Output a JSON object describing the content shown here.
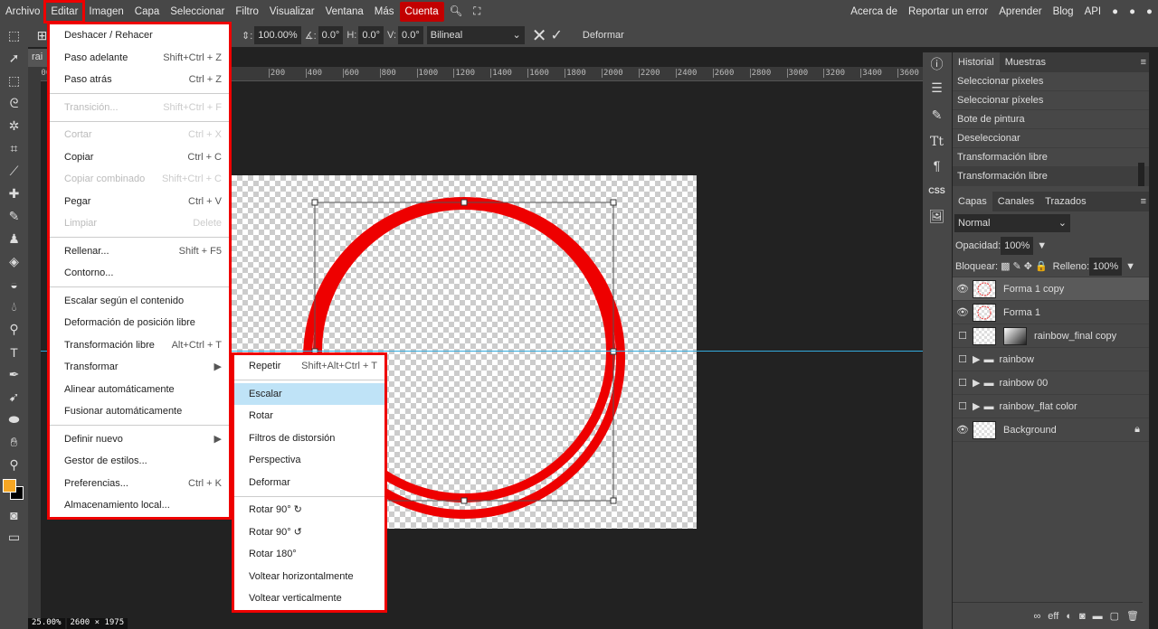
{
  "menubar": {
    "items": [
      "Archivo",
      "Editar",
      "Imagen",
      "Capa",
      "Seleccionar",
      "Filtro",
      "Visualizar",
      "Ventana",
      "Más",
      "Cuenta"
    ],
    "right": [
      "Acerca de",
      "Reportar un error",
      "Aprender",
      "Blog",
      "API"
    ]
  },
  "options": {
    "scale": "100.00%",
    "angle": "0.0°",
    "h_label": "H:",
    "h": "0.0°",
    "v_label": "V:",
    "v": "0.0°",
    "interp": "Bilineal",
    "warp": "Deformar"
  },
  "doc_tab": "rai",
  "ruler": [
    "200",
    "200",
    "400",
    "600",
    "800",
    "1000",
    "1200",
    "1400",
    "1600",
    "1800",
    "2000",
    "2200",
    "2400",
    "2600",
    "2800",
    "3000",
    "3200",
    "3400",
    "3600"
  ],
  "edit_menu": [
    {
      "label": "Deshacer / Rehacer",
      "shortcut": ""
    },
    {
      "label": "Paso adelante",
      "shortcut": "Shift+Ctrl + Z"
    },
    {
      "label": "Paso atrás",
      "shortcut": "Ctrl + Z"
    },
    "sep",
    {
      "label": "Transición...",
      "shortcut": "Shift+Ctrl + F",
      "disabled": true
    },
    "sep",
    {
      "label": "Cortar",
      "shortcut": "Ctrl + X",
      "disabled": true
    },
    {
      "label": "Copiar",
      "shortcut": "Ctrl + C"
    },
    {
      "label": "Copiar combinado",
      "shortcut": "Shift+Ctrl + C",
      "disabled": true
    },
    {
      "label": "Pegar",
      "shortcut": "Ctrl + V"
    },
    {
      "label": "Limpiar",
      "shortcut": "Delete",
      "disabled": true
    },
    "sep",
    {
      "label": "Rellenar...",
      "shortcut": "Shift + F5"
    },
    {
      "label": "Contorno...",
      "shortcut": ""
    },
    "sep",
    {
      "label": "Escalar según el contenido",
      "shortcut": ""
    },
    {
      "label": "Deformación de posición libre",
      "shortcut": ""
    },
    {
      "label": "Transformación libre",
      "shortcut": "Alt+Ctrl + T"
    },
    {
      "label": "Transformar",
      "shortcut": "▶"
    },
    {
      "label": "Alinear automáticamente",
      "shortcut": ""
    },
    {
      "label": "Fusionar automáticamente",
      "shortcut": ""
    },
    "sep",
    {
      "label": "Definir nuevo",
      "shortcut": "▶"
    },
    {
      "label": "Gestor de estilos...",
      "shortcut": ""
    },
    {
      "label": "Preferencias...",
      "shortcut": "Ctrl + K"
    },
    {
      "label": "Almacenamiento local...",
      "shortcut": ""
    }
  ],
  "transform_menu": [
    {
      "label": "Repetir",
      "shortcut": "Shift+Alt+Ctrl + T"
    },
    "sep",
    {
      "label": "Escalar",
      "shortcut": "",
      "highlighted": true
    },
    {
      "label": "Rotar",
      "shortcut": ""
    },
    {
      "label": "Filtros de distorsión",
      "shortcut": ""
    },
    {
      "label": "Perspectiva",
      "shortcut": ""
    },
    {
      "label": "Deformar",
      "shortcut": ""
    },
    "sep",
    {
      "label": "Rotar 90° ↻",
      "shortcut": ""
    },
    {
      "label": "Rotar 90° ↺",
      "shortcut": ""
    },
    {
      "label": "Rotar 180°",
      "shortcut": ""
    },
    {
      "label": "Voltear horizontalmente",
      "shortcut": ""
    },
    {
      "label": "Voltear verticalmente",
      "shortcut": ""
    }
  ],
  "history": {
    "tabs": [
      "Historial",
      "Muestras"
    ],
    "items": [
      "Seleccionar píxeles",
      "Seleccionar píxeles",
      "Bote de pintura",
      "Deseleccionar",
      "Transformación libre",
      "Transformación libre"
    ]
  },
  "layers": {
    "tabs": [
      "Capas",
      "Canales",
      "Trazados"
    ],
    "blend": "Normal",
    "opacity_label": "Opacidad:",
    "opacity": "100%",
    "lock_label": "Bloquear:",
    "fill_label": "Relleno:",
    "fill": "100%",
    "items": [
      {
        "name": "Forma 1 copy",
        "visible": true,
        "selected": true
      },
      {
        "name": "Forma 1",
        "visible": true
      },
      {
        "name": "rainbow_final copy",
        "visible": false
      },
      {
        "name": "rainbow",
        "visible": false,
        "folder": true
      },
      {
        "name": "rainbow 00",
        "visible": false,
        "folder": true
      },
      {
        "name": "rainbow_flat color",
        "visible": false,
        "folder": true
      },
      {
        "name": "Background",
        "visible": true,
        "locked": true
      }
    ]
  },
  "status": {
    "zoom": "25.00%",
    "size": "2600 × 1975"
  },
  "colors": {
    "accent_red": "#e00000",
    "shape": "#ee0000",
    "guide": "#33aadd",
    "foreground": "#f5a623"
  }
}
